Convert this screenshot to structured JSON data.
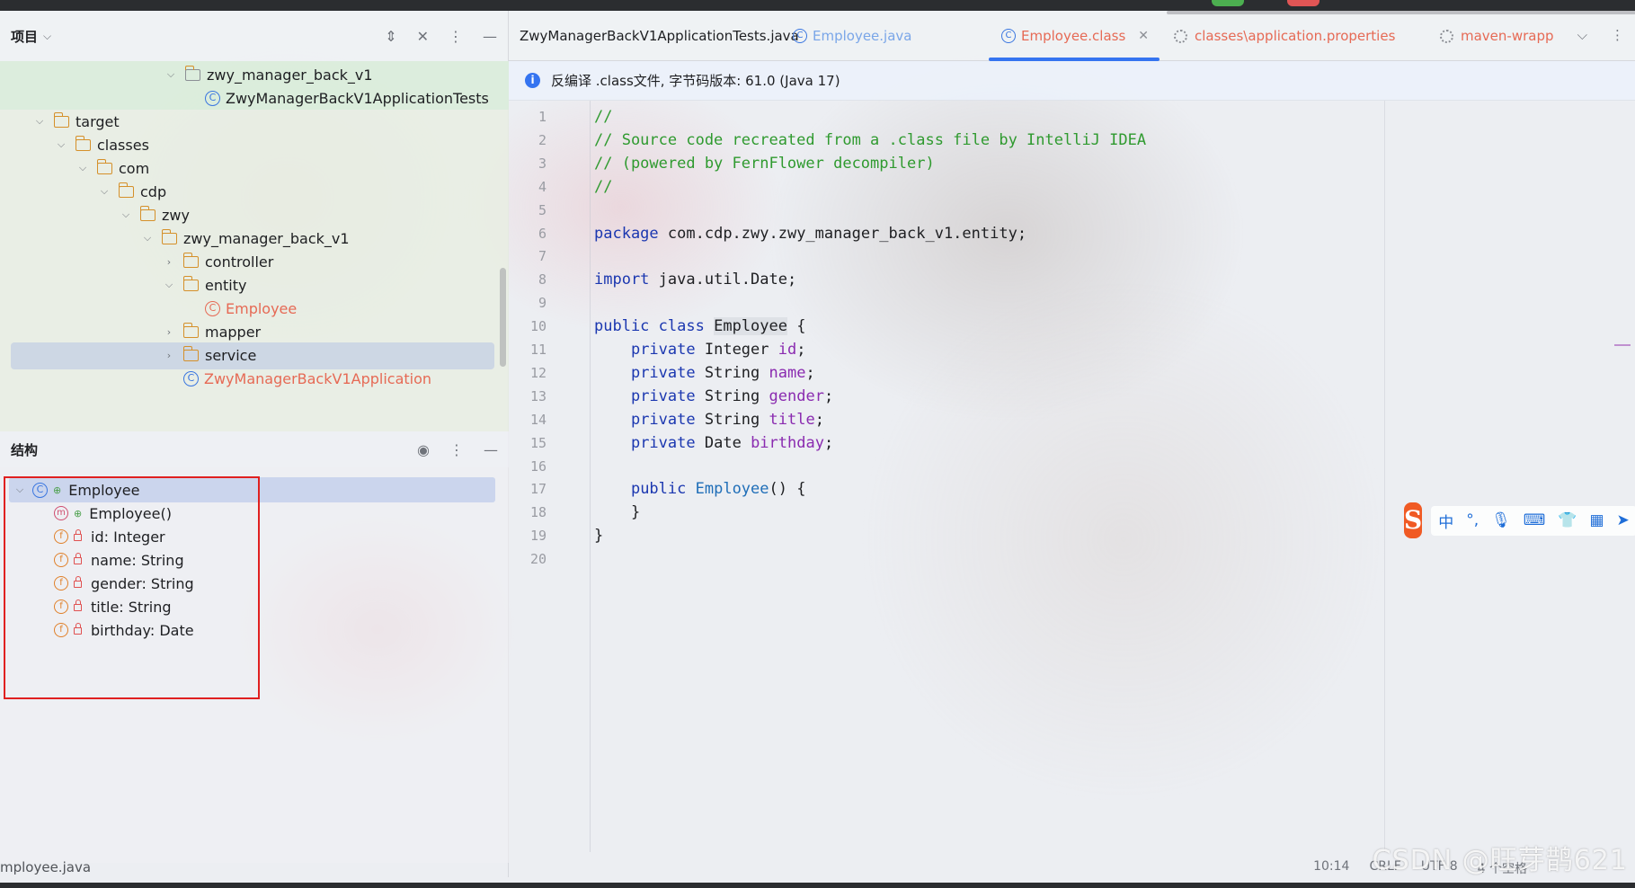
{
  "project_panel": {
    "title": "项目",
    "tree": [
      {
        "label": "zwy_manager_back_v1",
        "type": "module",
        "expanded": true
      },
      {
        "label": "ZwyManagerBackV1ApplicationTests",
        "type": "class"
      },
      {
        "label": "target",
        "type": "folder",
        "expanded": true
      },
      {
        "label": "classes",
        "type": "folder",
        "expanded": true
      },
      {
        "label": "com",
        "type": "folder",
        "expanded": true
      },
      {
        "label": "cdp",
        "type": "folder",
        "expanded": true
      },
      {
        "label": "zwy",
        "type": "folder",
        "expanded": true
      },
      {
        "label": "zwy_manager_back_v1",
        "type": "folder",
        "expanded": true
      },
      {
        "label": "controller",
        "type": "folder",
        "expanded": false
      },
      {
        "label": "entity",
        "type": "folder",
        "expanded": true
      },
      {
        "label": "Employee",
        "type": "class",
        "selected": true
      },
      {
        "label": "mapper",
        "type": "folder",
        "expanded": false
      },
      {
        "label": "service",
        "type": "folder",
        "expanded": false
      },
      {
        "label": "ZwyManagerBackV1Application",
        "type": "class"
      }
    ]
  },
  "structure_panel": {
    "title": "结构",
    "root": "Employee",
    "members": [
      {
        "label": "Employee()",
        "kind": "method"
      },
      {
        "label": "id: Integer",
        "kind": "field"
      },
      {
        "label": "name: String",
        "kind": "field"
      },
      {
        "label": "gender: String",
        "kind": "field"
      },
      {
        "label": "title: String",
        "kind": "field"
      },
      {
        "label": "birthday: Date",
        "kind": "field"
      }
    ]
  },
  "tabs": [
    {
      "label": "ZwyManagerBackV1ApplicationTests.java",
      "icon": "none"
    },
    {
      "label": "Employee.java",
      "icon": "class-icon"
    },
    {
      "label": "Employee.class",
      "icon": "class-icon",
      "active": true
    },
    {
      "label": "classes\\application.properties",
      "icon": "gear-icon"
    },
    {
      "label": "maven-wrapp",
      "icon": "gear-icon"
    }
  ],
  "info_bar": {
    "text": "反编译 .class文件, 字节码版本: 61.0 (Java 17)"
  },
  "code_lines": [
    {
      "n": "1",
      "text": "//"
    },
    {
      "n": "2",
      "text": "// Source code recreated from a .class file by IntelliJ IDEA"
    },
    {
      "n": "3",
      "text": "// (powered by FernFlower decompiler)"
    },
    {
      "n": "4",
      "text": "//"
    },
    {
      "n": "5",
      "text": ""
    },
    {
      "n": "6",
      "text": "package com.cdp.zwy.zwy_manager_back_v1.entity;"
    },
    {
      "n": "7",
      "text": ""
    },
    {
      "n": "8",
      "text": "import java.util.Date;"
    },
    {
      "n": "9",
      "text": ""
    },
    {
      "n": "10",
      "text": "public class Employee {"
    },
    {
      "n": "11",
      "text": "    private Integer id;"
    },
    {
      "n": "12",
      "text": "    private String name;"
    },
    {
      "n": "13",
      "text": "    private String gender;"
    },
    {
      "n": "14",
      "text": "    private String title;"
    },
    {
      "n": "15",
      "text": "    private Date birthday;"
    },
    {
      "n": "16",
      "text": ""
    },
    {
      "n": "17",
      "text": "    public Employee() {"
    },
    {
      "n": "18",
      "text": "    }"
    },
    {
      "n": "19",
      "text": "}"
    },
    {
      "n": "20",
      "text": ""
    }
  ],
  "ime_toolbar": {
    "logo": "S",
    "items": [
      "中",
      "°,",
      "mic-icon",
      "keyboard-icon",
      "shirt-icon",
      "grid-icon",
      "more-icon"
    ]
  },
  "status": {
    "left_file": "mployee.java",
    "position": "10:14",
    "line_sep": "CRLF",
    "encoding": "UTF-8",
    "indent": "4 个空格"
  },
  "watermark": "CSDN @旺芽鹊621",
  "colors": {
    "accent": "#3574f0",
    "keyword": "#1b37b0",
    "comment": "#2f9a2f",
    "field": "#8a2bb0",
    "highlight_box": "#e02020"
  }
}
